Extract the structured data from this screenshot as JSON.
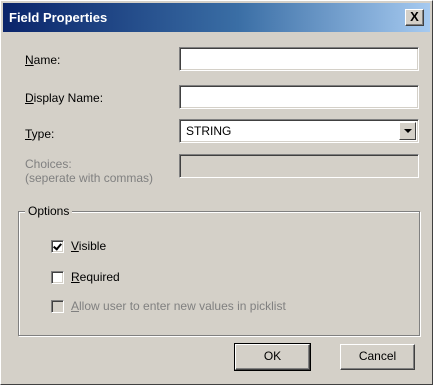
{
  "window": {
    "title": "Field Properties",
    "close_label": "X"
  },
  "form": {
    "name_label_key": "N",
    "name_label_rest": "ame:",
    "name_value": "",
    "display_name_label_key": "D",
    "display_name_label_rest": "isplay Name:",
    "display_name_value": "",
    "type_label_key": "T",
    "type_label_rest": "ype:",
    "type_value": "STRING",
    "choices_label_line1": "Choices:",
    "choices_label_line2": "(seperate with commas)",
    "choices_value": ""
  },
  "options": {
    "title": "Options",
    "visible_key": "V",
    "visible_rest": "isible",
    "visible_checked": true,
    "required_key": "R",
    "required_rest": "equired",
    "required_checked": false,
    "allow_key": "A",
    "allow_rest": "llow user to enter new values in picklist",
    "allow_checked": false
  },
  "buttons": {
    "ok": "OK",
    "cancel": "Cancel"
  }
}
